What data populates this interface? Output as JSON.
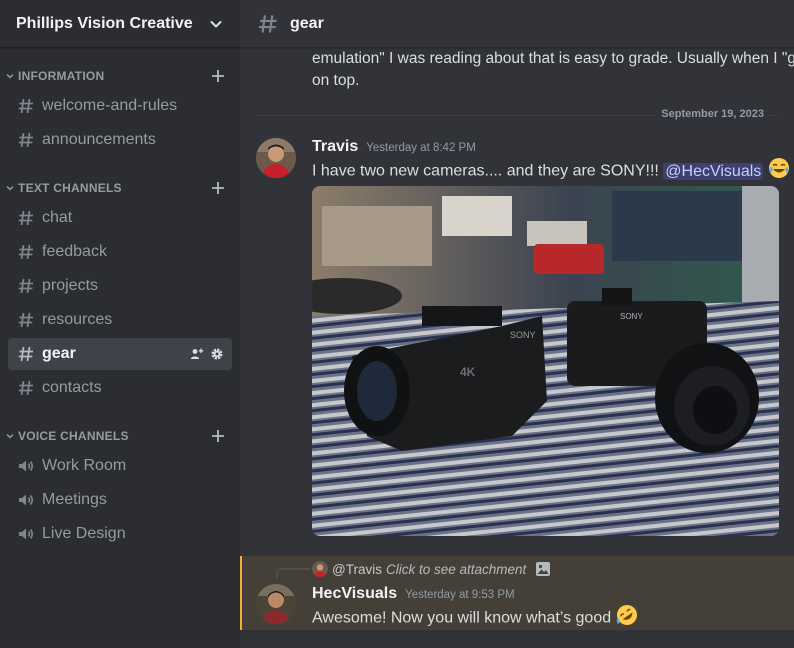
{
  "server": {
    "name": "Phillips Vision Creative"
  },
  "categories": [
    {
      "label": "INFORMATION",
      "channels": [
        {
          "label": "welcome-and-rules"
        },
        {
          "label": "announcements"
        }
      ]
    },
    {
      "label": "TEXT CHANNELS",
      "channels": [
        {
          "label": "chat"
        },
        {
          "label": "feedback"
        },
        {
          "label": "projects"
        },
        {
          "label": "resources"
        },
        {
          "label": "gear"
        },
        {
          "label": "contacts"
        }
      ]
    },
    {
      "label": "VOICE CHANNELS",
      "channels": [
        {
          "label": "Work Room"
        },
        {
          "label": "Meetings"
        },
        {
          "label": "Live Design"
        }
      ]
    }
  ],
  "active_channel": "gear",
  "header": {
    "title": "gear"
  },
  "previous_message": {
    "line1": "emulation\" I was reading about that is easy to grade. Usually when I \"gra",
    "line2": "on top."
  },
  "date_divider": "September 19, 2023",
  "messages": [
    {
      "author": "Travis",
      "timestamp": "Yesterday at 8:42 PM",
      "text": "I have two new cameras.... and they are SONY!!!",
      "mention": "@HecVisuals",
      "emoji": "joy-emoji",
      "attachment": {
        "brand_left": "SONY",
        "brand_right": "SONY",
        "badge": "4K"
      }
    },
    {
      "author": "HecVisuals",
      "timestamp": "Yesterday at 9:53 PM",
      "text": "Awesome! Now you will know what’s good",
      "emoji": "rofl-emoji",
      "reply": {
        "author": "@Travis",
        "content": "Click to see attachment"
      }
    }
  ],
  "colors": {
    "accent_mention": "#5865f2",
    "highlight_bar": "#f0b232",
    "highlight_bg": "#444038",
    "sidebar_bg": "#2b2d31",
    "main_bg": "#313338"
  }
}
